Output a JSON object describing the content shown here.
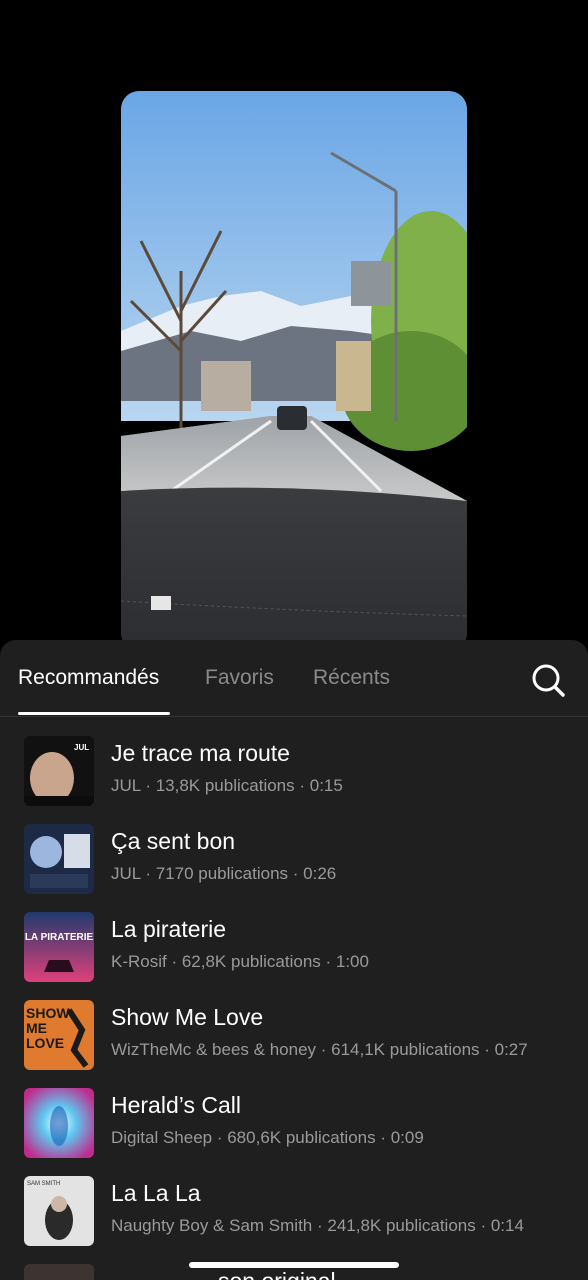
{
  "tabs": [
    {
      "label": "Recommandés",
      "active": true
    },
    {
      "label": "Favoris",
      "active": false
    },
    {
      "label": "Récents",
      "active": false
    }
  ],
  "search_icon": "search-icon",
  "tracks": [
    {
      "title": "Je trace ma route",
      "meta": "JUL · 13,8K publications · 0:15"
    },
    {
      "title": "Ça sent bon",
      "meta": "JUL · 7170 publications · 0:26"
    },
    {
      "title": "La piraterie",
      "meta": "K-Rosif · 62,8K publications · 1:00"
    },
    {
      "title": "Show Me Love",
      "meta": "WizTheMc & bees & honey · 614,1K publications · 0:27"
    },
    {
      "title": "Herald’s Call",
      "meta": "Digital Sheep · 680,6K publications · 0:09"
    },
    {
      "title": "La La La",
      "meta": "Naughty Boy & Sam Smith · 241,8K publications · 0:14"
    },
    {
      "title": "son original",
      "meta": ""
    }
  ],
  "covers": {
    "cover1_text": "JUL",
    "cover3_text": "LA PIRATERIE",
    "cover4_text": [
      "SHOW",
      "ME",
      "LOVE"
    ],
    "cover6_text": "SAM SMITH"
  },
  "colors": {
    "sheet_bg": "#1f1f1f",
    "muted_text": "#9a9a9a",
    "inactive_tab": "#8a8a8a"
  }
}
